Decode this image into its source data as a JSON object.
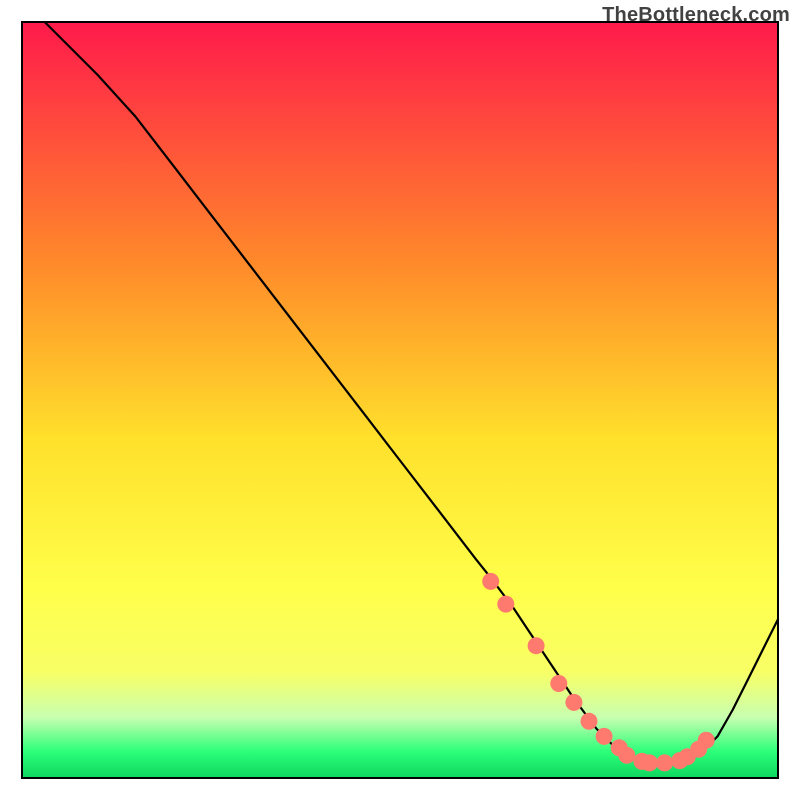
{
  "attribution": "TheBottleneck.com",
  "colors": {
    "gradient_top": "#ff1a4b",
    "gradient_mid_upper": "#ff8a2a",
    "gradient_mid": "#ffe02b",
    "gradient_lower": "#f8ff66",
    "gradient_green_light": "#c8ffb0",
    "gradient_green": "#2cff7a",
    "gradient_green_dark": "#0fd65e",
    "border": "#000000",
    "curve": "#000000",
    "marker": "#ff7a6e"
  },
  "chart_data": {
    "type": "line",
    "title": "",
    "xlabel": "",
    "ylabel": "",
    "xlim": [
      0,
      100
    ],
    "ylim": [
      0,
      100
    ],
    "series": [
      {
        "name": "bottleneck-curve",
        "x": [
          3,
          10,
          15,
          20,
          25,
          30,
          35,
          40,
          45,
          50,
          55,
          60,
          62,
          65,
          67,
          70,
          73,
          76,
          79,
          82,
          85,
          86,
          88,
          90,
          92,
          94,
          96,
          100
        ],
        "y": [
          100,
          93,
          87.5,
          81,
          74.5,
          68,
          61.5,
          55,
          48.5,
          42,
          35.5,
          29,
          26.5,
          22.5,
          19.5,
          15,
          10.5,
          6.5,
          3.5,
          2,
          2,
          2,
          2.5,
          3.5,
          5.5,
          9,
          13,
          21
        ]
      }
    ],
    "markers": {
      "name": "optimal-points",
      "x": [
        62,
        64,
        68,
        71,
        73,
        75,
        77,
        79,
        80,
        82,
        83,
        85,
        87,
        88,
        89.5,
        90.5
      ],
      "y": [
        26,
        23,
        17.5,
        12.5,
        10,
        7.5,
        5.5,
        4,
        3,
        2.2,
        2,
        2,
        2.3,
        2.8,
        3.8,
        5
      ]
    }
  }
}
